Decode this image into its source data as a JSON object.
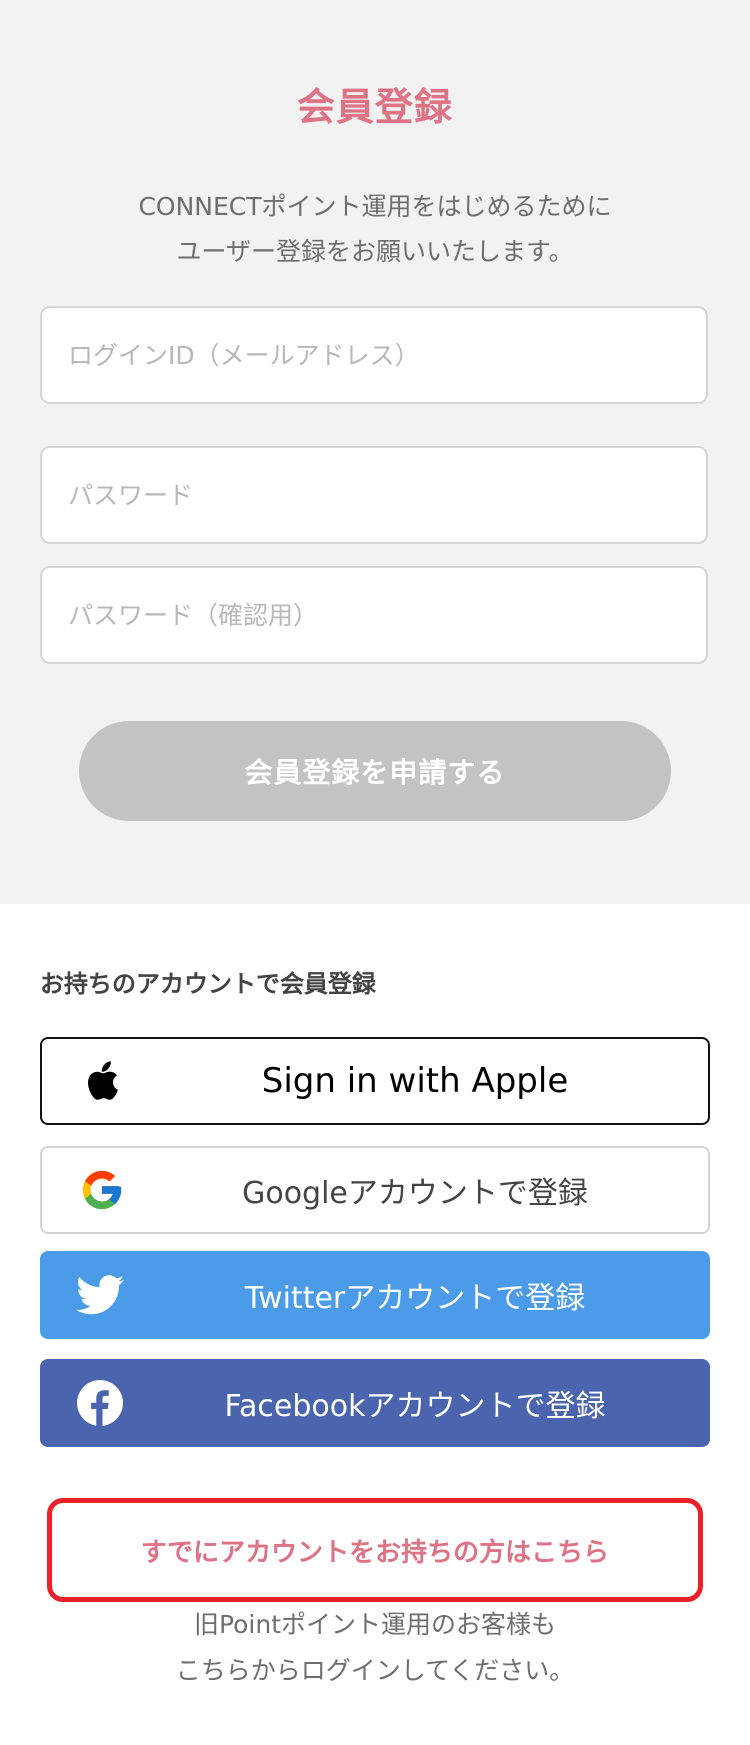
{
  "registration": {
    "title": "会員登録",
    "intro_line1": "CONNECTポイント運用をはじめるために",
    "intro_line2": "ユーザー登録をお願いいたします。",
    "login_id_placeholder": "ログインID（メールアドレス）",
    "password_placeholder": "パスワード",
    "password_confirm_placeholder": "パスワード（確認用）",
    "submit_label": "会員登録を申請する"
  },
  "social": {
    "heading": "お持ちのアカウントで会員登録",
    "buttons": [
      {
        "label": "Sign in with Apple",
        "icon": "apple-icon"
      },
      {
        "label": "Googleアカウントで登録",
        "icon": "google-icon"
      },
      {
        "label": "Twitterアカウントで登録",
        "icon": "twitter-icon",
        "color": "#4b9be8"
      },
      {
        "label": "Facebookアカウントで登録",
        "icon": "facebook-icon",
        "color": "#4a64ad"
      }
    ]
  },
  "existing": {
    "link_label": "すでにアカウントをお持ちの方はこちら",
    "note_line1": "旧Pointポイント運用のお客様も",
    "note_line2": "こちらからログインしてください。"
  },
  "colors": {
    "accent": "#dd7385",
    "highlight_border": "#e8212a",
    "disabled_button": "#c3c3c3"
  }
}
